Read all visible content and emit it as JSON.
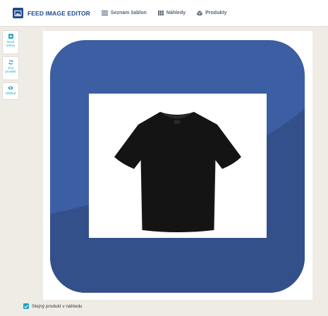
{
  "header": {
    "app_title": "FEED IMAGE EDITOR",
    "nav": [
      {
        "label": "Seznam šablon",
        "icon": "list-icon"
      },
      {
        "label": "Náhledy",
        "icon": "grid-icon"
      },
      {
        "label": "Produkty",
        "icon": "box-icon"
      }
    ]
  },
  "sidebar": {
    "buttons": [
      {
        "label_line1": "Nová",
        "label_line2": "vrstva",
        "icon": "plus-square-icon"
      },
      {
        "label_line1": "Jiný",
        "label_line2": "produkt",
        "icon": "refresh-icon"
      },
      {
        "label_line1": "Náhled",
        "label_line2": "",
        "icon": "eye-icon"
      }
    ]
  },
  "canvas": {
    "frame_color": "#3c5ea3",
    "frame_dark_color": "#34508a",
    "product": "black t-shirt image"
  },
  "footer": {
    "checkbox_label": "Stejný produkt v náhledu",
    "checked": true
  },
  "colors": {
    "brand": "#1f4a8a",
    "accent": "#1aa3c2"
  }
}
